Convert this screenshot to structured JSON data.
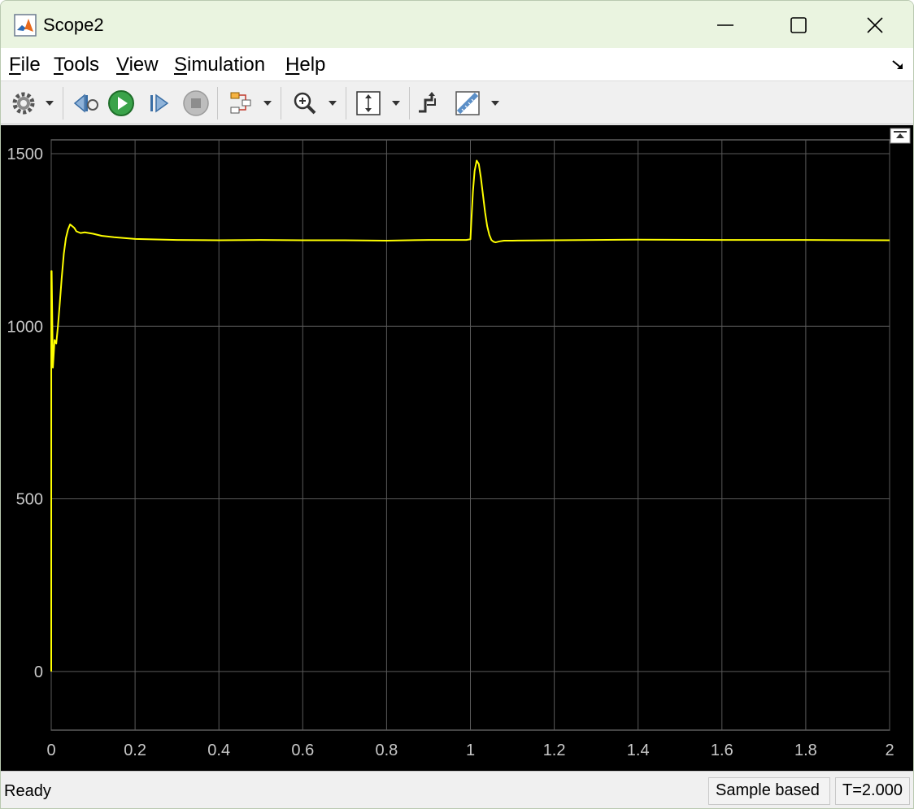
{
  "window": {
    "title": "Scope2"
  },
  "menu": [
    {
      "label": "File",
      "mnemonic": "F",
      "rest": "ile"
    },
    {
      "label": "Tools",
      "mnemonic": "T",
      "rest": "ools"
    },
    {
      "label": "View",
      "mnemonic": "V",
      "rest": "iew"
    },
    {
      "label": "Simulation",
      "mnemonic": "S",
      "rest": "imulation"
    },
    {
      "label": "Help",
      "mnemonic": "H",
      "rest": "elp"
    }
  ],
  "toolbar_icons": [
    "gear-icon",
    "step-back-icon",
    "run-icon",
    "step-forward-icon",
    "stop-icon",
    "signal-selector-icon",
    "zoom-icon",
    "autoscale-icon",
    "triggers-icon",
    "measurements-icon"
  ],
  "colors": {
    "trace": "#ffff00",
    "plot_bg": "#000000",
    "grid": "#5a5a5a",
    "tick_text": "#c8c8c8"
  },
  "status": {
    "state": "Ready",
    "mode": "Sample based",
    "time": "T=2.000"
  },
  "chart_data": {
    "type": "line",
    "title": "",
    "xlabel": "",
    "ylabel": "",
    "xlim": [
      0,
      2
    ],
    "ylim": [
      -170,
      1540
    ],
    "grid": true,
    "x_ticks": [
      0,
      0.2,
      0.4,
      0.6,
      0.8,
      1,
      1.2,
      1.4,
      1.6,
      1.8,
      2
    ],
    "x_tick_labels": [
      "0",
      "0.2",
      "0.4",
      "0.6",
      "0.8",
      "1",
      "1.2",
      "1.4",
      "1.6",
      "1.8",
      "2"
    ],
    "y_ticks": [
      0,
      500,
      1000,
      1500
    ],
    "y_tick_labels": [
      "0",
      "500",
      "1000",
      "1500"
    ],
    "series": [
      {
        "x": [
          0,
          0.0001,
          0.001,
          0.004,
          0.008,
          0.012,
          0.016,
          0.02,
          0.025,
          0.03,
          0.035,
          0.04,
          0.045,
          0.05,
          0.055,
          0.06,
          0.07,
          0.08,
          0.1,
          0.12,
          0.15,
          0.2,
          0.3,
          0.4,
          0.5,
          0.6,
          0.7,
          0.8,
          0.9,
          0.99,
          1.0,
          1.002,
          1.006,
          1.01,
          1.015,
          1.02,
          1.025,
          1.03,
          1.035,
          1.04,
          1.045,
          1.05,
          1.055,
          1.06,
          1.07,
          1.08,
          1.1,
          1.2,
          1.4,
          1.6,
          1.8,
          2.0
        ],
        "y": [
          0,
          1160,
          1160,
          880,
          960,
          950,
          1000,
          1060,
          1140,
          1210,
          1255,
          1280,
          1295,
          1290,
          1285,
          1275,
          1270,
          1272,
          1268,
          1262,
          1258,
          1253,
          1250,
          1249,
          1250,
          1249,
          1249,
          1248,
          1250,
          1250,
          1252,
          1300,
          1390,
          1450,
          1480,
          1470,
          1430,
          1380,
          1330,
          1290,
          1265,
          1250,
          1245,
          1243,
          1246,
          1248,
          1248,
          1249,
          1251,
          1250,
          1250,
          1249
        ]
      }
    ]
  }
}
